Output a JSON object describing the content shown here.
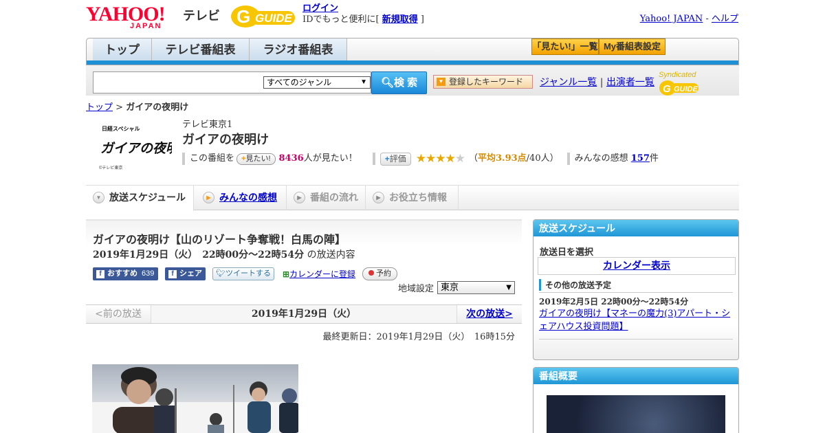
{
  "header": {
    "yahoo_logo": "YAHOO!",
    "yahoo_japan": "JAPAN",
    "tv_label": "テレビ",
    "gguide_logo": "GUIDE",
    "login_link": "ログイン",
    "login_prefix": "IDでもっと便利に[ ",
    "register_link": "新規取得",
    "login_suffix": " ]",
    "yahoo_japan_link": "Yahoo! JAPAN",
    "separator": " - ",
    "help_link": "ヘルプ"
  },
  "nav": {
    "tabs": [
      "トップ",
      "テレビ番組表",
      "ラジオ番組表"
    ],
    "mitai_list": "「見たい!」一覧",
    "my_bangumi": "My番組表設定"
  },
  "search": {
    "genre_select": "すべてのジャンル",
    "search_button": "検 索",
    "keyword_button": "登録したキーワード",
    "genre_list_link": "ジャンル一覧",
    "link_separator": " | ",
    "performer_link": "出演者一覧",
    "syndicated": "Syndicated",
    "gguide_mini": "GUIDE"
  },
  "breadcrumb": {
    "top": "トップ",
    "sep": " > ",
    "current": "ガイアの夜明け"
  },
  "program": {
    "logo_small": "日経スペシャル",
    "logo_main": "ガイアの夜明け",
    "logo_copyright": "©テレビ東京",
    "channel": "テレビ東京1",
    "title": "ガイアの夜明け",
    "mitai_prefix": "この番組を",
    "mitai_button": "見たい!",
    "mitai_count": "8436",
    "mitai_suffix": "人が見たい！",
    "hyoka_button": "評価",
    "rating_stars": 3.5,
    "avg_label": "（",
    "avg_text": "平均3.93点",
    "avg_people": "/40人）",
    "kanso_label": "みんなの感想",
    "kanso_count": "157",
    "kanso_unit": "件"
  },
  "subtabs": [
    "放送スケジュール",
    "みんなの感想",
    "番組の流れ",
    "お役立ち情報"
  ],
  "episode": {
    "title": "ガイアの夜明け【山のリゾート争奪戦！白馬の陣】",
    "date": "2019年1月29日（火）　22時00分～22時54分",
    "date_suffix": " の放送内容",
    "fb_label": "おすすめ",
    "fb_count": "639",
    "fb_share": "シェア",
    "tweet": "ツイートする",
    "calendar": "カレンダーに登録",
    "yoyaku": "予約",
    "region_label": "地域設定",
    "region_value": "東京"
  },
  "pager": {
    "prev": "<前の放送",
    "current": "2019年1月29日（火）",
    "next": "次の放送>"
  },
  "updated": "最終更新日：2019年1月29日（火）　16時15分",
  "sidebar": {
    "schedule_head": "放送スケジュール",
    "select_date": "放送日を選択",
    "calendar_link": "カレンダー表示",
    "other_head": "その他の放送予定",
    "other_date": "2019年2月5日  22時00分～22時54分",
    "other_link": "ガイアの夜明け【マネーの魔力(3)アパート・シェアハウス投資問題】",
    "gaiyo_head": "番組概要"
  },
  "colors": {
    "yahoo_red": "#ff0033",
    "accent_blue": "#1f8fd6",
    "link": "#0000cc",
    "orange": "#f2a100",
    "pink_count": "#cc0066"
  }
}
